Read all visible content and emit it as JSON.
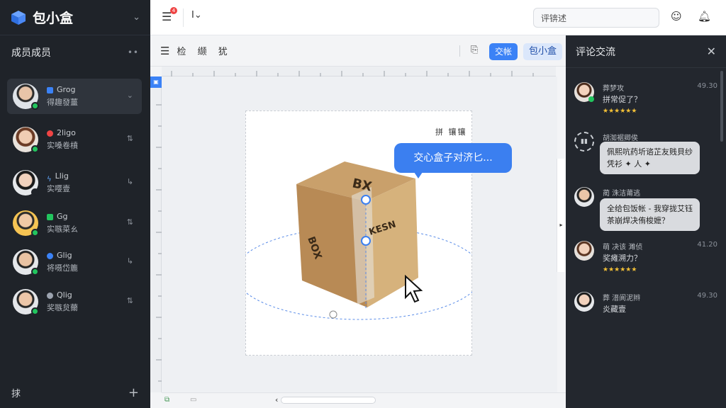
{
  "sidebar": {
    "brand": "包小盒",
    "section_title": "成员成员",
    "members": [
      {
        "tag": "Grog",
        "role": "得趣發薑",
        "tag_color": "#3b82f6"
      },
      {
        "tag": "2ligo",
        "role": "实嗓卷橨",
        "tag_color": "#ef4444"
      },
      {
        "tag": "Llig",
        "role": "实嘤壹",
        "tag_color": "#60a5fa"
      },
      {
        "tag": "Gg",
        "role": "实嗾菜ㄠ",
        "tag_color": "#22c55e"
      },
      {
        "tag": "Glig",
        "role": "将嗫岱簏",
        "tag_color": "#3b82f6"
      },
      {
        "tag": "Qlig",
        "role": "奖嗾炱薾",
        "tag_color": "#9ca3af"
      }
    ],
    "footer_label": "捄"
  },
  "topbar": {
    "badge": "4",
    "search_value": "评锛述"
  },
  "toolbar": {
    "label": "检 缬 犹",
    "btn_primary": "交帐",
    "btn_secondary": "包小盒"
  },
  "canvas": {
    "sheet_title": "拼 镶镶",
    "bubble_text": "交心盒子对济匕..."
  },
  "panel": {
    "title": "评论交流",
    "comments": [
      {
        "name": "葬梦攻",
        "time": "49.30",
        "text": "拼常促了？",
        "emoji": "★★★★★★"
      },
      {
        "name": "胡洳裾卿俟",
        "time": "",
        "text": "佩熙吭药圻谘芷友贱貝纱",
        "text2": "凭衫 ✦ 人 ✦"
      },
      {
        "name": "蔺 洙洁莆逃",
        "time": "",
        "text": "全给包饭帐 - 我穿拢艾钰",
        "text2": "茶崩焊决侑梭嬷？"
      },
      {
        "name": "萌 决该 濉侦",
        "time": "41.20",
        "text": "奖瘫溯力？",
        "emoji": "★★★★★★"
      },
      {
        "name": "葬 溍阆泥辫",
        "time": "49.30",
        "text": "炎藏壹"
      }
    ]
  }
}
